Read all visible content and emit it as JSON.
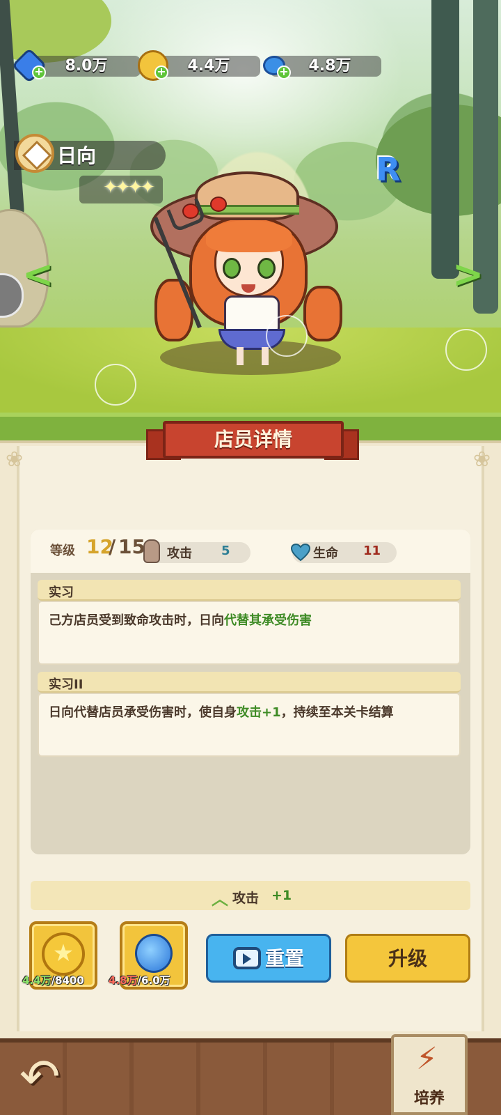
{
  "resources": [
    {
      "name": "gem",
      "icon": "diamond-icon",
      "value": "8.0万",
      "color": "#3a7ee8"
    },
    {
      "name": "gold",
      "icon": "gold-coin-icon",
      "value": "4.4万",
      "color": "#f2c43c"
    },
    {
      "name": "water",
      "icon": "water-drop-icon",
      "value": "4.8万",
      "color": "#3b8fe6"
    }
  ],
  "character": {
    "name": "日向",
    "stars": "✦✦✦✦",
    "rarity": "R"
  },
  "nav": {
    "prev": "<",
    "next": ">"
  },
  "panel": {
    "title": "店员详情",
    "level_label": "等级",
    "level_current": "12",
    "level_sep": "/",
    "level_max": "15",
    "attack_label": "攻击",
    "attack_value": "5",
    "hp_label": "生命",
    "hp_value": "11",
    "skills": [
      {
        "title": "实习",
        "text_plain": "己方店员受到致命攻击时，日向",
        "text_highlight": "代替其承受伤害",
        "text_tail": ""
      },
      {
        "title": "实习II",
        "text_plain": "日向代替店员承受伤害时，使自身",
        "text_highlight": "攻击+1",
        "text_tail": "，持续至本关卡结算"
      }
    ],
    "bonus_label": "攻击",
    "bonus_value": "+1"
  },
  "costs": [
    {
      "icon": "star-coin-icon",
      "have": "4.4万",
      "need": "/8400",
      "sufficient": true
    },
    {
      "icon": "water-drop-icon",
      "have": "4.8万",
      "need": "/6.0万",
      "sufficient": false
    }
  ],
  "buttons": {
    "reset": "重置",
    "upgrade": "升级",
    "back": "↶",
    "cultivate": "培养"
  },
  "colors": {
    "banner": "#c8442f",
    "highlight_green": "#3e8b25",
    "level_gold": "#d6a42c",
    "reset_blue": "#48b4ef",
    "upgrade_yellow": "#f4c63c"
  }
}
